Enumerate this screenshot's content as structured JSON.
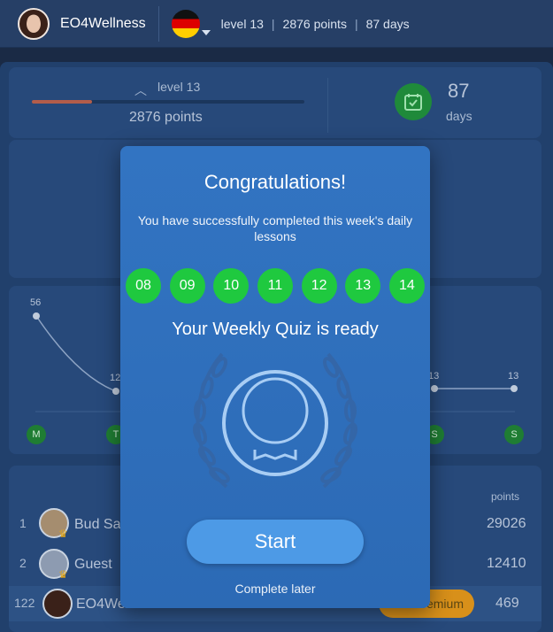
{
  "header": {
    "username": "EO4Wellness",
    "level": "level 13",
    "points": "2876 points",
    "days": "87 days",
    "separator": "|",
    "language_flag": "germany-flag"
  },
  "dashboard": {
    "level_label": "level 13",
    "points_label": "2876 points",
    "level_progress_fraction": 0.22,
    "days_number": "87",
    "days_label": "days"
  },
  "chart": {
    "values_shown": [
      "56",
      "12",
      "13",
      "13"
    ],
    "day_letters": [
      "M",
      "T",
      "S",
      "S"
    ]
  },
  "leaderboard": {
    "points_header": "points",
    "rows": [
      {
        "rank": "1",
        "name": "Bud Sa",
        "points": "29026"
      },
      {
        "rank": "2",
        "name": "Guest",
        "points": "12410"
      },
      {
        "rank": "122",
        "name": "EO4Wellness",
        "badge": "Premium",
        "points": "469"
      }
    ]
  },
  "modal": {
    "title": "Congratulations!",
    "subtitle": "You have successfully completed this week's daily lessons",
    "days": [
      "08",
      "09",
      "10",
      "11",
      "12",
      "13",
      "14"
    ],
    "quiz_text": "Your Weekly Quiz is ready",
    "start_label": "Start",
    "later_label": "Complete later"
  },
  "colors": {
    "modal_bg": "#3274c2",
    "day_green": "#1fc93f",
    "start_button": "#4d9ae6",
    "premium": "#d8901a"
  }
}
